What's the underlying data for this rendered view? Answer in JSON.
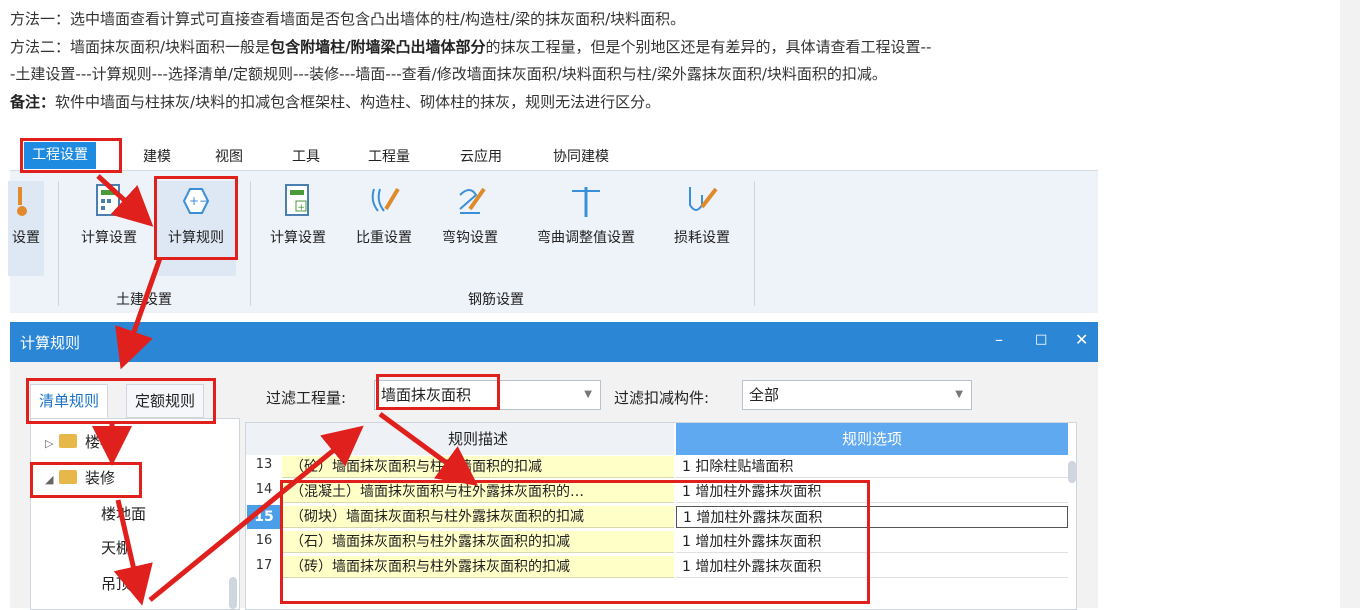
{
  "article": {
    "line1": "方法一：选中墙面查看计算式可直接查看墙面是否包含凸出墙体的柱/构造柱/梁的抹灰面积/块料面积。",
    "line2_prefix": "方法二：墙面抹灰面积/块料面积一般是",
    "line2_bold": "包含附墙柱/附墙梁凸出墙体部分",
    "line2_suffix": "的抹灰工程量，但是个别地区还是有差异的，具体请查看工程设置--",
    "line3": "-土建设置---计算规则---选择清单/定额规则---装修---墙面---查看/修改墙面抹灰面积/块料面积与柱/梁外露抹灰面积/块料面积的扣减。",
    "line4_bold": "备注：",
    "line4_text": "软件中墙面与柱抹灰/块料的扣减包含框架柱、构造柱、砌体柱的抹灰，规则无法进行区分。"
  },
  "menu": {
    "tabs": [
      "工程设置",
      "建模",
      "视图",
      "工具",
      "工程量",
      "云应用",
      "协同建模"
    ]
  },
  "ribbon": {
    "partial_button": "设置",
    "tujian_buttons": [
      "计算设置",
      "计算规则"
    ],
    "tujian_group": "土建设置",
    "rebar_buttons": [
      "计算设置",
      "比重设置",
      "弯钩设置",
      "弯曲调整值设置",
      "损耗设置"
    ],
    "rebar_group": "钢筋设置"
  },
  "dialog": {
    "title": "计算规则",
    "controls": [
      "–",
      "□",
      "✕"
    ],
    "tabs": [
      "清单规则",
      "定额规则"
    ],
    "filter_qty_label": "过滤工程量:",
    "filter_qty_value": "墙面抹灰面积",
    "filter_member_label": "过滤扣减构件:",
    "filter_member_value": "全部",
    "tree": [
      "楼梯",
      "装修",
      "楼地面",
      "天棚",
      "吊顶"
    ],
    "grid_header_desc": "规则描述",
    "grid_header_opt": "规则选项",
    "rows": [
      {
        "num": "13",
        "desc": "（砼）墙面抹灰面积与柱贴墙面积的扣减",
        "opt": "1  扣除柱贴墙面积"
      },
      {
        "num": "14",
        "desc": "（混凝土）墙面抹灰面积与柱外露抹灰面积的…",
        "opt": "1  增加柱外露抹灰面积"
      },
      {
        "num": "15",
        "desc": "（砌块）墙面抹灰面积与柱外露抹灰面积的扣减",
        "opt": "1  增加柱外露抹灰面积"
      },
      {
        "num": "16",
        "desc": "（石）墙面抹灰面积与柱外露抹灰面积的扣减",
        "opt": "1  增加柱外露抹灰面积"
      },
      {
        "num": "17",
        "desc": "（砖）墙面抹灰面积与柱外露抹灰面积的扣减",
        "opt": "1  增加柱外露抹灰面积"
      }
    ]
  },
  "colors": {
    "accent": "#2b87d6",
    "highlight": "#e0201c",
    "desc_bg": "#ffffc8",
    "header_blue": "#5ea9f0"
  }
}
